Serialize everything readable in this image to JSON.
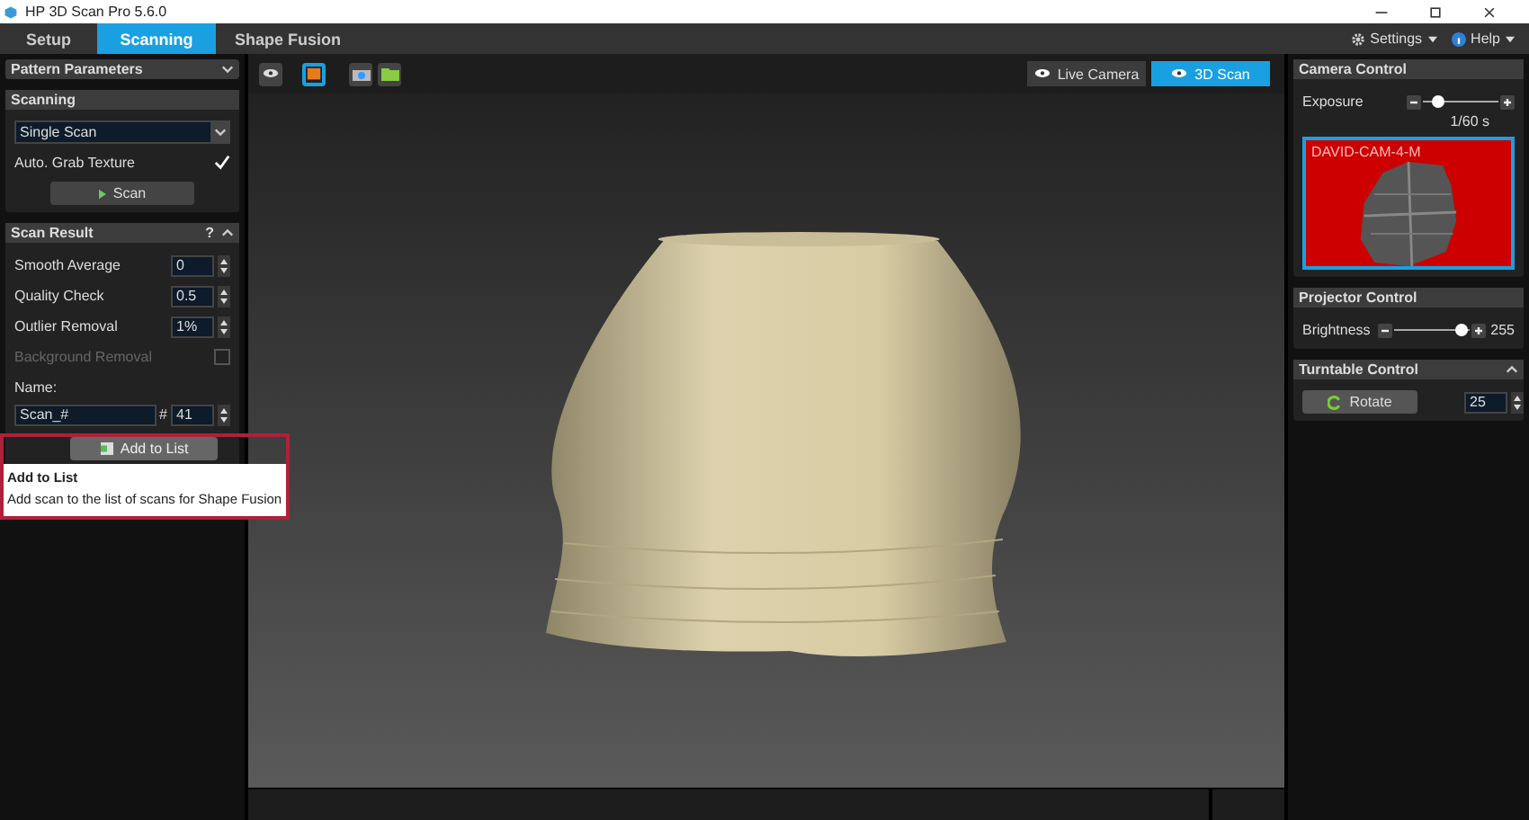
{
  "window": {
    "title": "HP 3D Scan Pro 5.6.0"
  },
  "tabs": [
    {
      "label": "Setup",
      "selected": false
    },
    {
      "label": "Scanning",
      "selected": true
    },
    {
      "label": "Shape Fusion",
      "selected": false
    }
  ],
  "menu": [
    {
      "label": "Settings",
      "kind": "gear"
    },
    {
      "label": "Help",
      "kind": "help"
    }
  ],
  "left": {
    "pattern_header": "Pattern Parameters",
    "scanning": {
      "header": "Scanning",
      "mode": "Single Scan",
      "auto_grab": {
        "label": "Auto. Grab Texture",
        "checked": true
      },
      "scan_button": "Scan"
    },
    "scan_result": {
      "header": "Scan Result",
      "help": "?",
      "rows": [
        {
          "label": "Smooth Average",
          "value": "0"
        },
        {
          "label": "Quality Check",
          "value": "0.5"
        },
        {
          "label": "Outlier Removal",
          "value": "1%"
        }
      ],
      "background_removal": {
        "label": "Background Removal",
        "checked": false,
        "disabled": true
      },
      "name_label": "Name:",
      "name_value": "Scan_#",
      "hash": "#",
      "number": "41",
      "add_button": "Add to List"
    },
    "tooltip": {
      "title": "Add to List",
      "text": "Add scan to the list of scans for Shape Fusion"
    }
  },
  "view_modes": [
    {
      "label": "Live Camera",
      "selected": false
    },
    {
      "label": "3D Scan",
      "selected": true
    }
  ],
  "right": {
    "camera": {
      "header": "Camera Control",
      "exposure_label": "Exposure",
      "level": 0.2,
      "reading": "1/60 s",
      "camera_name": "DAVID-CAM-4-M"
    },
    "projector": {
      "header": "Projector Control",
      "brightness_label": "Brightness",
      "level": 0.9,
      "reading": "255"
    },
    "turntable": {
      "header": "Turntable Control",
      "rotate_button": "Rotate",
      "value": "25"
    }
  }
}
